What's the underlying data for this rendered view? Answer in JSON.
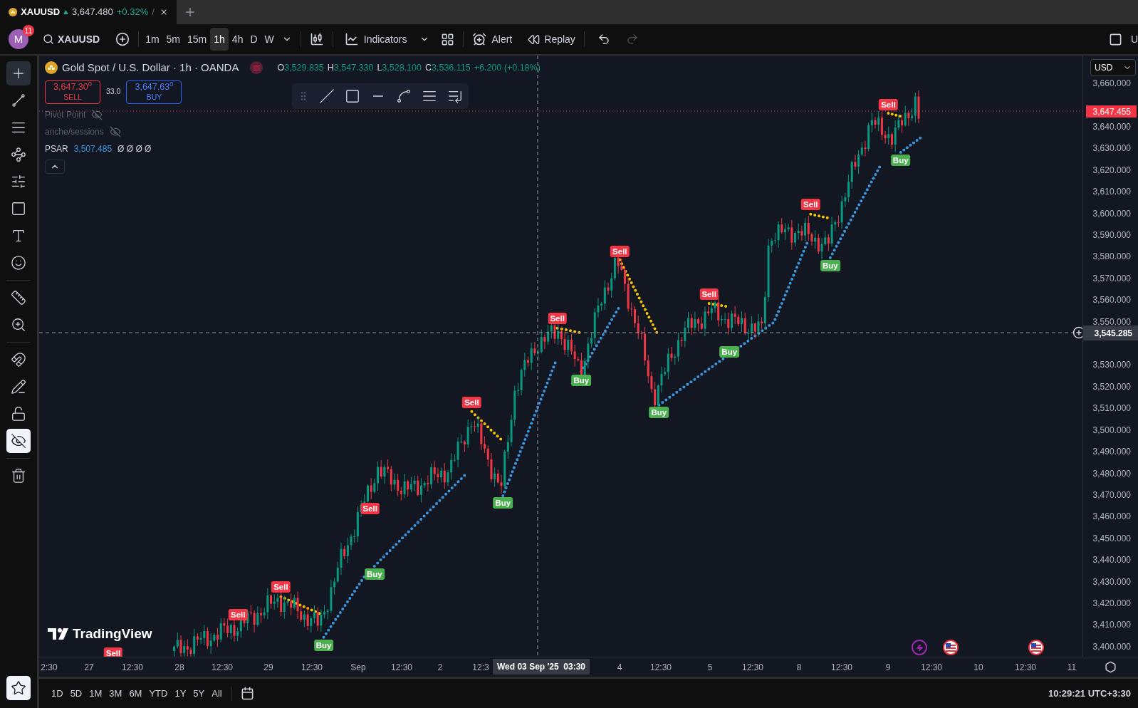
{
  "tab": {
    "symbol": "XAUUSD",
    "price": "3,647.480",
    "change": "+0.32%",
    "separator": "/"
  },
  "toolbar": {
    "avatar": "M",
    "badge": "11",
    "symbol": "XAUUSD",
    "intervals": [
      {
        "label": "1m",
        "selected": false
      },
      {
        "label": "5m",
        "selected": false
      },
      {
        "label": "15m",
        "selected": false
      },
      {
        "label": "1h",
        "selected": true
      },
      {
        "label": "4h",
        "selected": false
      },
      {
        "label": "D",
        "selected": false
      },
      {
        "label": "W",
        "selected": false
      }
    ],
    "indicators": "Indicators",
    "alert": "Alert",
    "replay": "Replay",
    "edge_text": "U"
  },
  "tools": [
    {
      "selected": true,
      "on": false
    },
    {
      "selected": false,
      "on": false
    },
    {
      "selected": false,
      "on": false
    },
    {
      "selected": false,
      "on": false
    },
    {
      "selected": false,
      "on": false
    },
    {
      "selected": false,
      "on": false
    },
    {
      "selected": false,
      "on": false
    },
    {
      "selected": false,
      "on": false
    },
    {
      "selected": false,
      "on": false
    },
    {
      "selected": false,
      "on": false
    },
    {
      "selected": false,
      "on": false
    },
    {
      "selected": false,
      "on": false
    },
    {
      "selected": false,
      "on": false
    },
    {
      "selected": false,
      "on": true
    },
    {
      "selected": false,
      "on": false
    },
    {
      "selected": false,
      "on": true
    }
  ],
  "legend": {
    "title": "Gold Spot / U.S. Dollar · 1h · OANDA",
    "ohlc": [
      {
        "key": "O",
        "value": "3,529.835"
      },
      {
        "key": "H",
        "value": "3,547.330"
      },
      {
        "key": "L",
        "value": "3,528.100"
      },
      {
        "key": "C",
        "value": "3,536.115"
      }
    ],
    "change": "+6.200 (+0.18%)"
  },
  "trade": {
    "sell": {
      "price": "3,647.30$^{0}$",
      "label": "SELL"
    },
    "spread": "33.0",
    "buy": {
      "price": "3,647.63$^{0}$",
      "label": "BUY"
    }
  },
  "indicators": [
    {
      "name": "Pivot Point",
      "hidden": true
    },
    {
      "name": "anche/sessions",
      "hidden": true
    },
    {
      "name": "PSAR",
      "hidden": false,
      "value": "3,507.485",
      "extra": "Ø Ø Ø Ø"
    }
  ],
  "signals": [
    {
      "kind": "sell",
      "label": "Sell"
    },
    {
      "kind": "sell",
      "label": "Sell"
    },
    {
      "kind": "sell",
      "label": "Sell"
    },
    {
      "kind": "buy",
      "label": "Buy"
    },
    {
      "kind": "sell",
      "label": "Sell"
    },
    {
      "kind": "buy",
      "label": "Buy"
    },
    {
      "kind": "sell",
      "label": "Sell"
    },
    {
      "kind": "buy",
      "label": "Buy"
    },
    {
      "kind": "sell",
      "label": "Sell"
    },
    {
      "kind": "buy",
      "label": "Buy"
    },
    {
      "kind": "sell",
      "label": "Sell"
    },
    {
      "kind": "buy",
      "label": "Buy"
    },
    {
      "kind": "sell",
      "label": "Sell"
    },
    {
      "kind": "buy",
      "label": "Buy"
    },
    {
      "kind": "sell",
      "label": "Sell"
    },
    {
      "kind": "buy",
      "label": "Buy"
    },
    {
      "kind": "sell",
      "label": "Sell"
    },
    {
      "kind": "buy",
      "label": "Buy"
    }
  ],
  "logo": {
    "text": "TradingView"
  },
  "price_scale": {
    "currency": "USD",
    "ticks": [
      "3,660.000",
      "3,640.000",
      "3,630.000",
      "3,620.000",
      "3,610.000",
      "3,600.000",
      "3,590.000",
      "3,580.000",
      "3,570.000",
      "3,560.000",
      "3,550.000",
      "3,530.000",
      "3,520.000",
      "3,510.000",
      "3,500.000",
      "3,490.000",
      "3,480.000",
      "3,470.000",
      "3,460.000",
      "3,450.000",
      "3,440.000",
      "3,430.000",
      "3,420.000",
      "3,410.000",
      "3,400.000"
    ],
    "last_price": "3,647.455",
    "crosshair_price": "3,545.285"
  },
  "time_scale": {
    "labels": [
      "2:30",
      "27",
      "12:30",
      "28",
      "12:30",
      "29",
      "12:30",
      "Sep",
      "12:30",
      "2",
      "12:3",
      "4",
      "12:30",
      "5",
      "12:30",
      "8",
      "12:30",
      "9",
      "12:30",
      "10",
      "12:30",
      "11"
    ],
    "crosshair_time": "Wed 03 Sep '25  03:30"
  },
  "ranges": [
    "1D",
    "5D",
    "1M",
    "3M",
    "6M",
    "YTD",
    "1Y",
    "5Y",
    "All"
  ],
  "clock": "10:29:21 UTC+3:30"
}
